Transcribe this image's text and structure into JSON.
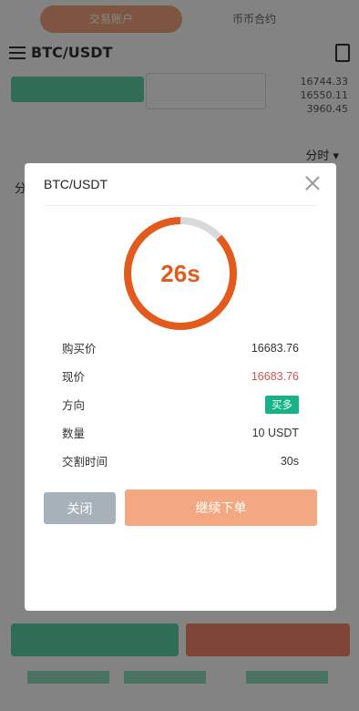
{
  "background": {
    "tabs": [
      "交易账户",
      "币币合约"
    ],
    "pair": "BTC/USDT",
    "stats": [
      "16744.33",
      "16550.11",
      "3960.45"
    ],
    "dropdown": "分时 ▾",
    "left_label": "分"
  },
  "modal": {
    "title": "BTC/USDT",
    "countdown": "26s",
    "countdown_progress": 0.87,
    "ring_color": "#e35b1c",
    "rows": [
      {
        "label": "购买价",
        "value": "16683.76"
      },
      {
        "label": "现价",
        "value": "16683.76",
        "color": "#d9534f"
      },
      {
        "label": "方向",
        "value": "买多",
        "badge": true
      },
      {
        "label": "数量",
        "value": "10 USDT"
      },
      {
        "label": "交割时间",
        "value": "30s"
      }
    ],
    "close_label": "关闭",
    "continue_label": "继续下单"
  }
}
